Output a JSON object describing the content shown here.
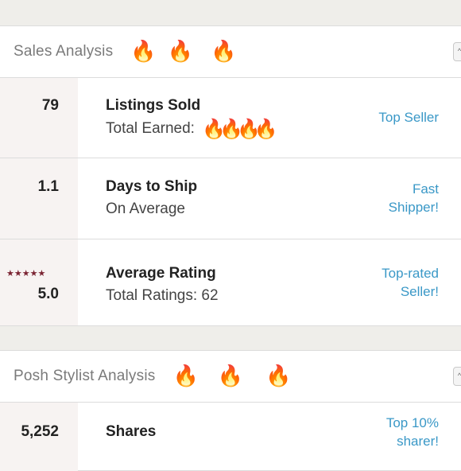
{
  "sales": {
    "title": "Sales Analysis",
    "fire_icons": [
      "fire-icon",
      "fire-icon",
      "fire-icon"
    ],
    "rows": [
      {
        "left_value": "79",
        "label": "Listings Sold",
        "sub": "Total Earned:",
        "right": [
          "Top Seller"
        ]
      },
      {
        "left_value": "1.1",
        "label": "Days to Ship",
        "sub": "On Average",
        "right": [
          "Fast",
          "Shipper!"
        ]
      },
      {
        "left_value": "5.0",
        "stars": "★★★★★",
        "label": "Average Rating",
        "sub": "Total Ratings: 62",
        "right": [
          "Top-rated",
          "Seller!"
        ]
      }
    ]
  },
  "stylist": {
    "title": "Posh Stylist Analysis",
    "rows": [
      {
        "left_value": "5,252",
        "label": "Shares",
        "right": [
          "Top 10%",
          "sharer!"
        ]
      }
    ]
  },
  "colors": {
    "link": "#3a98c7",
    "star": "#7b2433",
    "fire": "#f26b1d"
  }
}
